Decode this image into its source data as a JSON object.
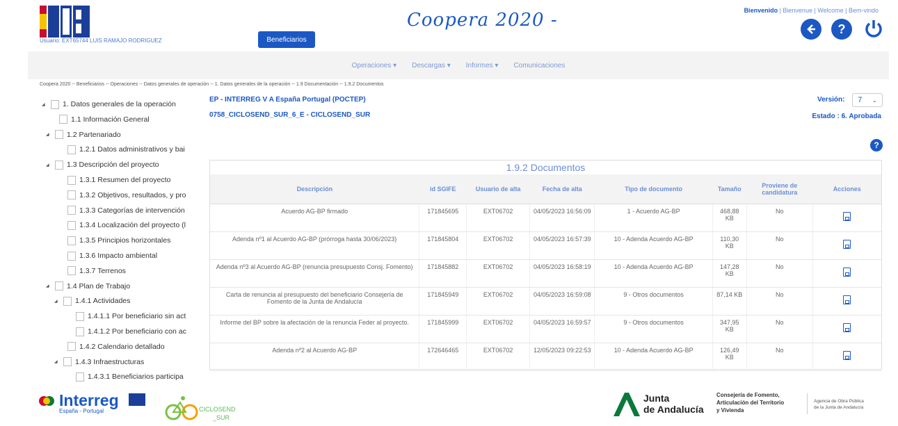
{
  "header": {
    "user": "Usuario: EXT65744 LUIS RAMAJO RODRIGUEZ",
    "beneficiarios_button": "Beneficiarios",
    "app_title": "Coopera 2020 -",
    "lang_welcome": "Bienvenido",
    "lang_others": " | Bienvenue | Welcome | Bem-vindo",
    "icons": [
      "back-icon",
      "help-icon",
      "power-icon"
    ]
  },
  "nav": {
    "items": [
      "Operaciones ▾",
      "Descargas ▾",
      "Informes ▾",
      "Comunicaciones"
    ]
  },
  "breadcrumb": "Coopera 2020 -- Beneficiarios -- Operaciones -- Datos generales de operación -- 1. Datos generales de la operación -- 1.9 Documentación -- 1.9.2 Documentos",
  "tree": [
    {
      "label": "1. Datos generales de la operación",
      "caret": true,
      "indent": 0
    },
    {
      "label": "1.1 Información General",
      "caret": false,
      "indent": 1
    },
    {
      "label": "1.2 Partenariado",
      "caret": true,
      "indent": 0.5
    },
    {
      "label": "1.2.1 Datos administrativos y bai",
      "caret": false,
      "indent": 2
    },
    {
      "label": "1.3 Descripción del proyecto",
      "caret": true,
      "indent": 0.5
    },
    {
      "label": "1.3.1 Resumen del proyecto",
      "caret": false,
      "indent": 2
    },
    {
      "label": "1.3.2 Objetivos, resultados, y pro",
      "caret": false,
      "indent": 2
    },
    {
      "label": "1.3.3 Categorías de intervención",
      "caret": false,
      "indent": 2
    },
    {
      "label": "1.3.4 Localización del proyecto (l",
      "caret": false,
      "indent": 2
    },
    {
      "label": "1.3.5 Principios horizontales",
      "caret": false,
      "indent": 2
    },
    {
      "label": "1.3.6 Impacto ambiental",
      "caret": false,
      "indent": 2
    },
    {
      "label": "1.3.7 Terrenos",
      "caret": false,
      "indent": 2
    },
    {
      "label": "1.4 Plan de Trabajo",
      "caret": true,
      "indent": 0.5
    },
    {
      "label": "1.4.1 Actividades",
      "caret": true,
      "indent": 1.5
    },
    {
      "label": "1.4.1.1 Por beneficiario sin act",
      "caret": false,
      "indent": 3
    },
    {
      "label": "1.4.1.2 Por beneficiario con ac",
      "caret": false,
      "indent": 3
    },
    {
      "label": "1.4.2 Calendario detallado",
      "caret": false,
      "indent": 2
    },
    {
      "label": "1.4.3 Infraestructuras",
      "caret": true,
      "indent": 1.5
    },
    {
      "label": "1.4.3.1 Beneficiarios participa",
      "caret": false,
      "indent": 3
    }
  ],
  "operation": {
    "programme": "EP - INTERREG V A España Portugal (POCTEP)",
    "code": "0758_CICLOSEND_SUR_6_E - CICLOSEND_SUR",
    "version_label": "Versión:",
    "version_value": "7",
    "estado": "Estado : 6. Aprobada"
  },
  "documents": {
    "caption": "1.9.2 Documentos",
    "headers": [
      "Descripción",
      "id SGIFE",
      "Usuario de alta",
      "Fecha de alta",
      "Tipo de documento",
      "Tamaño",
      "Proviene de candidatura",
      "Acciones"
    ],
    "rows": [
      {
        "desc": "Acuerdo AG-BP firmado",
        "id": "171845695",
        "user": "EXT06702",
        "date": "04/05/2023 16:56:09",
        "tipo": "1 - Acuerdo AG-BP",
        "size": "468,88 KB",
        "cand": "No"
      },
      {
        "desc": "Adenda nº1 al Acuerdo AG-BP (prórroga hasta 30/06/2023)",
        "id": "171845804",
        "user": "EXT06702",
        "date": "04/05/2023 16:57:39",
        "tipo": "10 - Adenda Acuerdo AG-BP",
        "size": "110,30 KB",
        "cand": "No"
      },
      {
        "desc": "Adenda nº3 al Acuerdo AG-BP (renuncia presupuesto Consj. Fomento)",
        "id": "171845882",
        "user": "EXT06702",
        "date": "04/05/2023 16:58:19",
        "tipo": "10 - Adenda Acuerdo AG-BP",
        "size": "147,28 KB",
        "cand": "No"
      },
      {
        "desc": "Carta de renuncia al presupuesto del beneficiario Consejería de Fomento de la Junta de Andalucía",
        "id": "171845949",
        "user": "EXT06702",
        "date": "04/05/2023 16:59:08",
        "tipo": "9 - Otros documentos",
        "size": "87,14 KB",
        "cand": "No"
      },
      {
        "desc": "Informe del BP sobre la afectación de la renuncia Feder al proyecto.",
        "id": "171845999",
        "user": "EXT06702",
        "date": "04/05/2023 16:59:57",
        "tipo": "9 - Otros documentos",
        "size": "347,95 KB",
        "cand": "No"
      },
      {
        "desc": "Adenda nº2 al Acuerdo AG-BP",
        "id": "172646465",
        "user": "EXT06702",
        "date": "12/05/2023 09:22:53",
        "tipo": "10 - Adenda Acuerdo AG-BP",
        "size": "126,49 KB",
        "cand": "No"
      }
    ]
  },
  "footer": {
    "interreg": "Interreg",
    "interreg_sub": "España - Portugal",
    "ciclo_1": "CICLOSEND",
    "ciclo_2": "_SUR",
    "junta_1": "Junta",
    "junta_2": "de Andalucía",
    "consej_1": "Consejería de Fomento,",
    "consej_2": "Articulación del Territorio",
    "consej_3": "y Vivienda",
    "agencia_1": "Agencia de Obra Pública",
    "agencia_2": "de la Junta de Andalucía"
  },
  "colors": {
    "brand": "#1b58c4",
    "link": "#6b8ed6"
  }
}
